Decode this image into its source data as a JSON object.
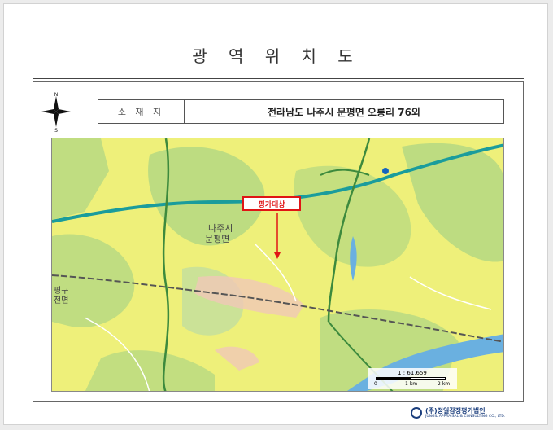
{
  "document": {
    "title": "광 역 위 치 도",
    "location_label": "소 재 지",
    "location_value": "전라남도 나주시 문평면 오룡리 76외"
  },
  "compass": {
    "north": "N",
    "south": "S"
  },
  "map": {
    "target_label": "평가대상",
    "place_labels": {
      "county_1": "나주시",
      "county_2": "문평면",
      "west_1": "평구",
      "west_2": "전면"
    },
    "scale": {
      "ratio": "1 : 61,659",
      "ticks": [
        "0",
        "1 km",
        "2 km"
      ]
    },
    "colors": {
      "land": "#eef07a",
      "forest": "#b7d982",
      "expressway": "#1a9c9c",
      "road": "#3d8a3d",
      "railway": "#555555",
      "river": "#6ab0e0",
      "target_marker": "#e01515"
    }
  },
  "footer": {
    "company": "(주)정일감정평가법인",
    "company_sub": "JUNGIL APPRAISAL & CONSULTING CO., LTD."
  }
}
